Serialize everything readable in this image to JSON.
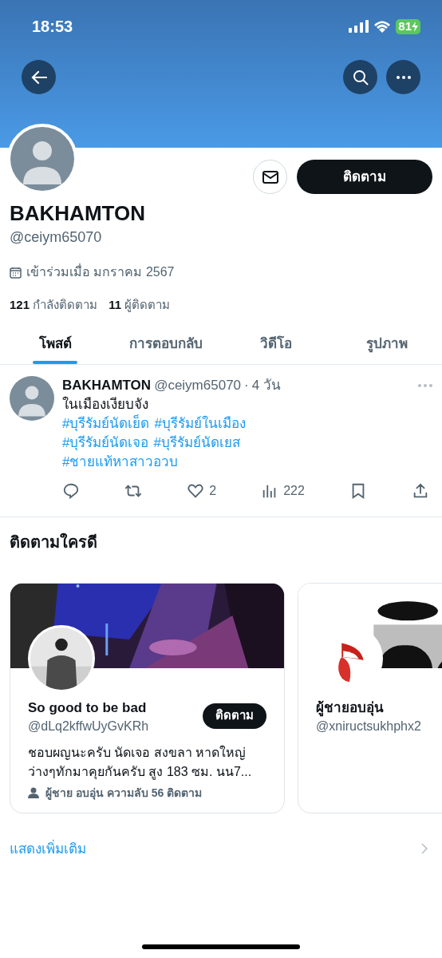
{
  "status_bar": {
    "time": "18:53",
    "battery": "81"
  },
  "profile": {
    "name": "BAKHAMTON",
    "handle": "@ceiym65070",
    "joined": "เข้าร่วมเมื่อ มกราคม 2567",
    "following_count": "121",
    "following_label": "กำลังติดตาม",
    "followers_count": "11",
    "followers_label": "ผู้ติดตาม",
    "follow_button": "ติดตาม"
  },
  "tabs": [
    {
      "label": "โพสต์",
      "selected": true
    },
    {
      "label": "การตอบกลับ",
      "selected": false
    },
    {
      "label": "วิดีโอ",
      "selected": false
    },
    {
      "label": "รูปภาพ",
      "selected": false
    }
  ],
  "posts": [
    {
      "name": "BAKHAMTON",
      "handle": "@ceiym65070",
      "separator": "·",
      "time": "4 วัน",
      "text": "ในเมืองเงียบจัง",
      "hashtag_lines": [
        [
          "#บุรีรัมย์นัดเย็ด",
          "#บุรีรัมย์ในเมือง"
        ],
        [
          "#บุรีรัมย์นัดเจอ",
          "#บุรีรัมย์นัดเยส"
        ],
        [
          "#ชายแท้หาสาวอวบ"
        ]
      ],
      "likes": "2",
      "views": "222"
    }
  ],
  "who_to_follow": {
    "title": "ติดตามใครดี",
    "cards": [
      {
        "kind": "full",
        "name": "So good to be bad",
        "handle": "@dLq2kffwUyGvKRh",
        "follow_button": "ติดตาม",
        "bio": "ชอบผญนะครับ นัดเจอ สงขลา หาดใหญ่ ว่างๆทักมาคุยกันครับ สูง 183 ซม. นน7...",
        "meta": "ผู้ชาย อบอุ่น ความลับ 56 ติดตาม"
      },
      {
        "kind": "partial",
        "name": "ผู้ชายอบอุ่น",
        "handle": "@xniructsukhphx2"
      }
    ],
    "show_more": "แสดงเพิ่มเติม"
  }
}
